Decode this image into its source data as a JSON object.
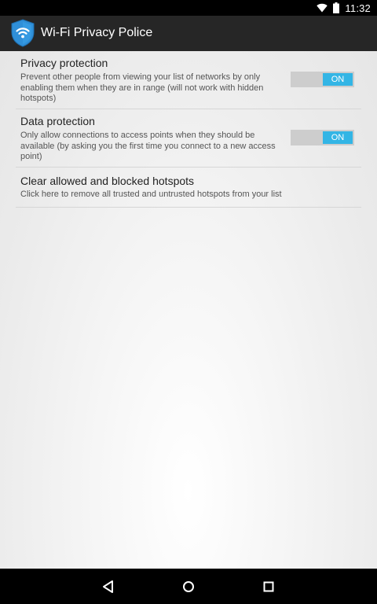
{
  "status_bar": {
    "time": "11:32",
    "icons": [
      "wifi-icon",
      "battery-icon"
    ]
  },
  "action_bar": {
    "title": "Wi-Fi Privacy Police",
    "icon": "shield-wifi-icon"
  },
  "preferences": [
    {
      "title": "Privacy protection",
      "summary": "Prevent other people from viewing your list of networks by only enabling them when they are in range (will not work with hidden hotspots)",
      "switch_label": "ON",
      "checked": true
    },
    {
      "title": "Data protection",
      "summary": "Only allow connections to access points when they should be available (by asking you the first time you connect to a new access point)",
      "switch_label": "ON",
      "checked": true
    },
    {
      "title": "Clear allowed and blocked hotspots",
      "summary": "Click here to remove all trusted and untrusted hotspots from your list"
    }
  ],
  "navigation_bar": {
    "buttons": [
      "back-icon",
      "home-icon",
      "recents-icon"
    ]
  },
  "colors": {
    "accent": "#33b5e5",
    "action_bar": "#262626",
    "switch_track": "#cdcdcd"
  }
}
